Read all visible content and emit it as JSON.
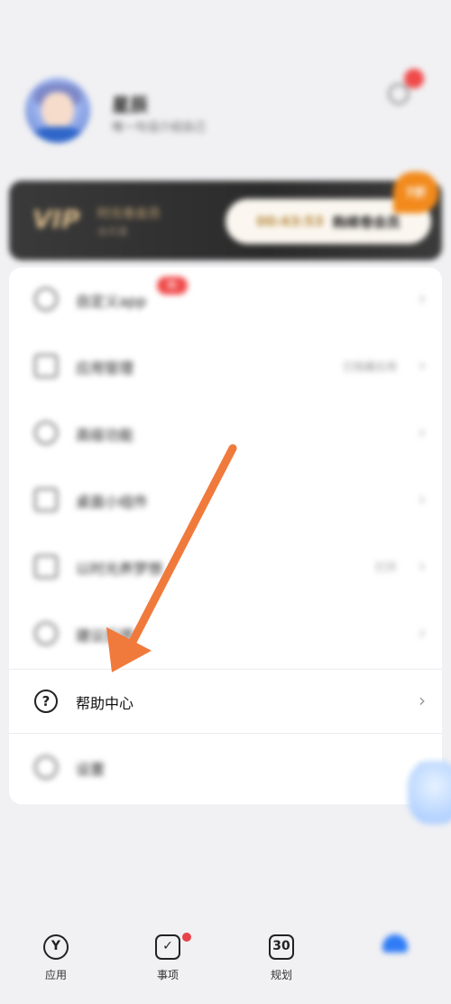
{
  "profile": {
    "name": "星辰",
    "signature": "唯一句话介绍自己"
  },
  "vip": {
    "badge": "VIP",
    "title": "时光卷会员",
    "subtitle": "未开通",
    "countdown": "00:43:53",
    "buy_label": "购续卷会员",
    "tag": "7折"
  },
  "menu": {
    "items": [
      {
        "label": "自定义app",
        "value": "",
        "icon": "custom-app-icon",
        "badge": "新"
      },
      {
        "label": "应用管理",
        "value": "已隐藏应用",
        "icon": "grid-icon"
      },
      {
        "label": "高级功能",
        "value": "",
        "icon": "hand-icon"
      },
      {
        "label": "桌面小组件",
        "value": "",
        "icon": "widget-icon"
      },
      {
        "label": "以时光养梦想",
        "value": "打开",
        "icon": "cup-icon"
      },
      {
        "label": "建议反馈",
        "value": "",
        "icon": "bulb-icon"
      },
      {
        "label": "帮助中心",
        "value": "",
        "icon": "question-circle-icon"
      },
      {
        "label": "设置",
        "value": "",
        "icon": "gear-icon"
      }
    ]
  },
  "tabs": [
    {
      "label": "应用",
      "icon_glyph": "Y",
      "icon": "app-hex-icon"
    },
    {
      "label": "事项",
      "icon_glyph": "✓",
      "icon": "checkbox-icon",
      "has_dot": true
    },
    {
      "label": "规划",
      "icon_glyph": "30",
      "icon": "calendar-30-icon"
    },
    {
      "label": "",
      "icon": "mine-icon",
      "active": true
    }
  ],
  "colors": {
    "background": "#f1f1f3",
    "vip_gold": "#c9a878",
    "badge_red": "#f04a4a",
    "arrow_orange": "#f07a3c",
    "active_blue": "#2f7cf6"
  }
}
